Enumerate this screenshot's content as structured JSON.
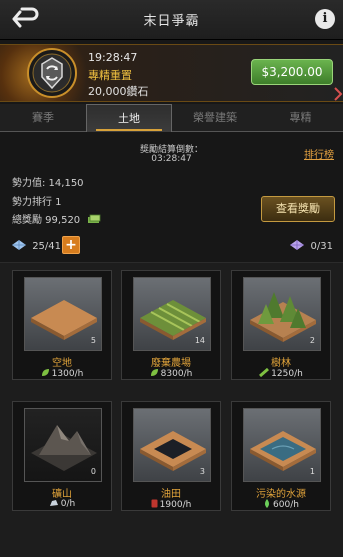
{
  "header": {
    "title": "末日爭霸"
  },
  "banner": {
    "time": "19:28:47",
    "subtitle": "專精重置",
    "reward": "20,000鑽石",
    "price": "$3,200.00"
  },
  "tabs": [
    {
      "label": "賽季",
      "active": false
    },
    {
      "label": "土地",
      "active": true
    },
    {
      "label": "榮譽建築",
      "active": false
    },
    {
      "label": "專精",
      "active": false
    }
  ],
  "stats": {
    "countdown_label": "獎勵結算倒數：",
    "countdown_time": "03:28:47",
    "rank_link": "排行榜",
    "power": "勢力值: 14,150",
    "rank": "勢力排行 1",
    "total_reward": "總獎勵 99,520",
    "reward_button": "查看獎勵"
  },
  "resources": {
    "left": "25/41",
    "right": "0/31"
  },
  "lands": [
    {
      "name": "空地",
      "count": "5",
      "rate": "1300/h",
      "icon": "leaf-icon"
    },
    {
      "name": "廢棄農場",
      "count": "14",
      "rate": "8300/h",
      "icon": "leaf-icon"
    },
    {
      "name": "樹林",
      "count": "2",
      "rate": "1250/h",
      "icon": "wood-icon"
    },
    {
      "name": "礦山",
      "count": "0",
      "rate": "0/h",
      "icon": "stone-icon"
    },
    {
      "name": "油田",
      "count": "3",
      "rate": "1900/h",
      "icon": "oil-icon"
    },
    {
      "name": "污染的水源",
      "count": "1",
      "rate": "600/h",
      "icon": "water-icon"
    }
  ],
  "colors": {
    "accent": "#e0a33a",
    "buy_green": "#4f9a36",
    "plus_orange": "#d77d1e"
  }
}
